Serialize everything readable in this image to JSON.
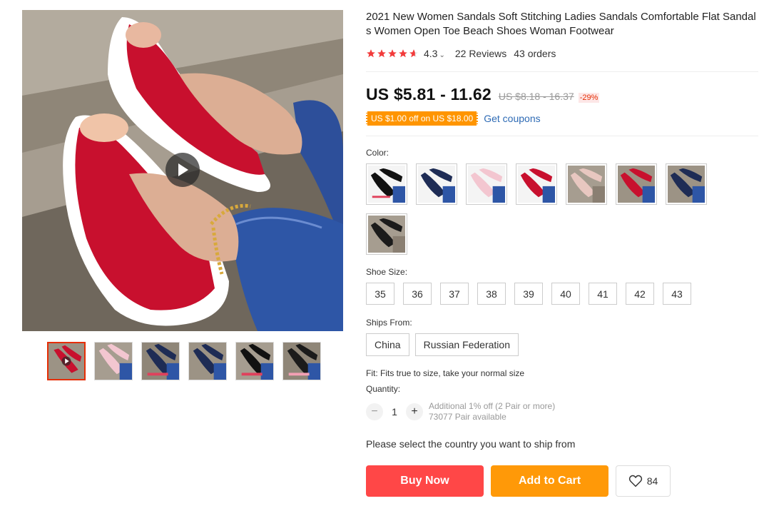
{
  "product": {
    "title": "2021 New Women Sandals Soft Stitching Ladies Sandals Comfortable Flat Sandals Women Open Toe Beach Shoes Woman Footwear",
    "rating": "4.3",
    "rating_stars": 4.3,
    "reviews": "22 Reviews",
    "orders": "43 orders"
  },
  "price": {
    "current": "US $5.81 - 11.62",
    "original": "US $8.18 - 16.37",
    "discount": "-29%"
  },
  "coupon": {
    "tag": "US $1.00 off on US $18.00",
    "link": "Get coupons"
  },
  "color": {
    "label": "Color:",
    "swatches": [
      "black-blue",
      "navy",
      "pink",
      "red",
      "beige",
      "red-strap",
      "navy-strap",
      "black-strap"
    ]
  },
  "size": {
    "label": "Shoe Size:",
    "options": [
      "35",
      "36",
      "37",
      "38",
      "39",
      "40",
      "41",
      "42",
      "43"
    ]
  },
  "ships_from": {
    "label": "Ships From:",
    "options": [
      "China",
      "Russian Federation"
    ]
  },
  "fit": "Fit: Fits true to size, take your normal size",
  "quantity": {
    "label": "Quantity:",
    "minus": "−",
    "value": "1",
    "plus": "+",
    "additional": "Additional 1% off (2 Pair or more)",
    "available": "73077 Pair available"
  },
  "ship_message": "Please select the country you want to ship from",
  "actions": {
    "buy": "Buy Now",
    "cart": "Add to Cart",
    "wishlist_count": "84"
  },
  "colors": {
    "accent": "#ff4747",
    "orange": "#ff9908",
    "star": "#f23b3b",
    "link": "#2e6bb5"
  },
  "icons": [
    "play-icon",
    "star-icon",
    "chevron-down-icon",
    "heart-icon"
  ]
}
